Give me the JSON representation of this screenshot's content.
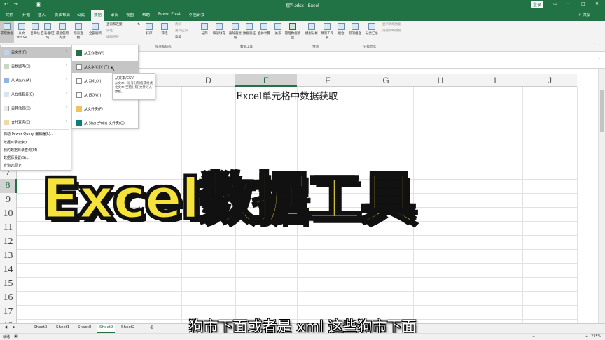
{
  "title_bar": {
    "file_title": "摆料.xlsx - Excel",
    "login": "登录",
    "share": "共享"
  },
  "tabs": [
    "文件",
    "开始",
    "插入",
    "页面布局",
    "公式",
    "数据",
    "审阅",
    "视图",
    "帮助",
    "Power Pivot",
    "告诉我"
  ],
  "ribbon": {
    "get_data": "获取数据",
    "from_text_csv": "从文本/CSV",
    "from_web": "自网站",
    "from_table": "自表格/区域",
    "recent_sources": "最近使用的源",
    "existing_conn": "现有连接",
    "refresh_all": "全部刷新",
    "queries_conn": "查询和连接",
    "properties": "属性",
    "edit_links": "编辑链接",
    "sort": "排序",
    "filter": "筛选",
    "clear": "清除",
    "reapply": "重新应用",
    "advanced": "高级",
    "text_to_cols": "分列",
    "flash_fill": "快速填充",
    "remove_dup": "删除重复值",
    "data_validation": "数据验证",
    "consolidate": "合并计算",
    "relationships": "关系",
    "manage_model": "管理数据模型",
    "what_if": "模拟分析",
    "forecast_sheet": "预测工作表",
    "group": "组合",
    "ungroup": "取消组合",
    "subtotal": "分类汇总",
    "show_detail": "显示明细数据",
    "hide_detail": "隐藏明细数据",
    "grp_sort": "排序和筛选",
    "grp_tools": "数据工具",
    "grp_forecast": "预测",
    "grp_outline": "分级显示"
  },
  "columns": [
    "D",
    "E",
    "F",
    "G",
    "H",
    "I",
    "J"
  ],
  "rows": [
    "7",
    "8",
    "9",
    "10",
    "11",
    "12",
    "13",
    "14",
    "15",
    "16",
    "17",
    "18"
  ],
  "cell_text": "Excel单元格中数据获取",
  "menu": {
    "from_file": "自文件(F)",
    "from_database": "自数据库(D)",
    "from_azure": "从 Azure(A)",
    "from_online": "从在线服务(E)",
    "from_other": "自其他源(O)",
    "combine": "合并查询(C)",
    "launch_pq": "启动 Power Query 编辑器(L)...",
    "catalog_search": "数据目录搜索(C)",
    "my_catalog": "我的数据目录查询(M)",
    "source_settings": "数据源设置(S)...",
    "query_options": "查询选项(P)"
  },
  "submenu": {
    "from_workbook": "从工作簿(W)",
    "from_text_csv": "从文本/CSV (T)",
    "from_xml": "从 XML(X)",
    "from_json": "从 JSON(J)",
    "from_folder": "从文件夹(F)",
    "from_sharepoint": "从 SharePoint 文件夹(O)"
  },
  "tooltip": {
    "title": "从文本/CSV",
    "body": "从文本、逗号分隔值或格式化文本(空格分隔)文件导入数据。"
  },
  "sheets": [
    "Sheet3",
    "Sheet1",
    "Sheet8",
    "Sheet9",
    "Sheet2"
  ],
  "active_sheet": "Sheet9",
  "status": {
    "ready": "就绪",
    "zoom": "235%"
  },
  "overlay_title": "Excel数据工具",
  "subtitle": "狗市下面或者是 xml 这些狗市下面"
}
